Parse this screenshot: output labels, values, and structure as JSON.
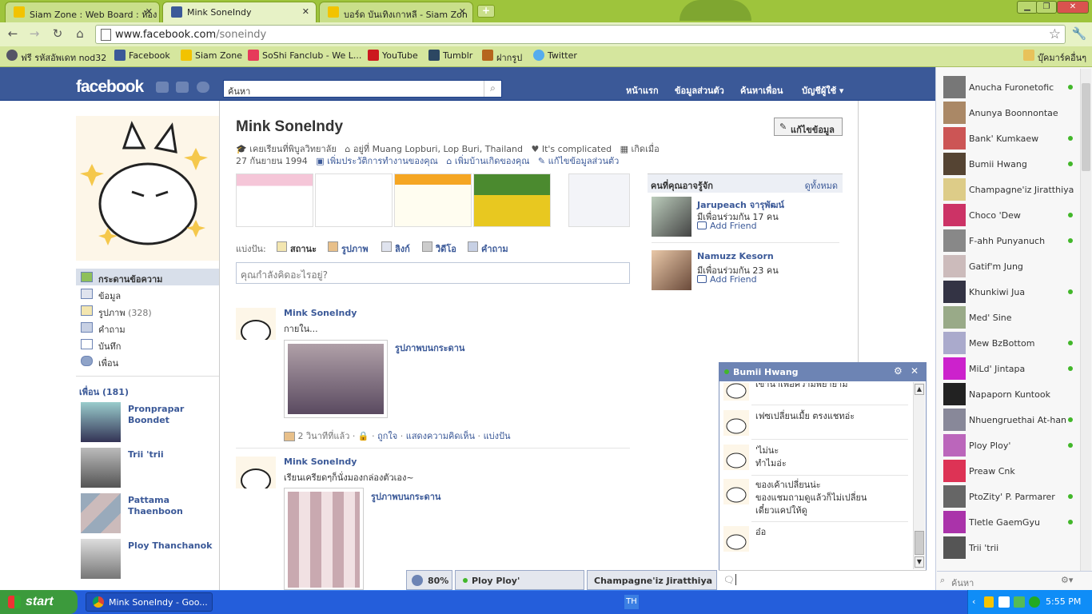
{
  "browser": {
    "tabs": [
      {
        "title": "Siam Zone : Web Board : ห้อง",
        "active": false
      },
      {
        "title": "Mink SoneIndy",
        "active": true
      },
      {
        "title": "บอร์ด บันเทิงเกาหลี - Siam Zon",
        "active": false
      }
    ],
    "url_domain": "www.facebook.com",
    "url_path": "/soneindy",
    "bookmarks": [
      "ฟรี รหัสอัพเดท nod32",
      "Facebook",
      "Siam Zone",
      "SoShi Fanclub - We L...",
      "YouTube",
      "Tumblr",
      "ฝากรูป",
      "Twitter"
    ],
    "other_bookmarks": "บุ๊คมาร์คอื่นๆ"
  },
  "fb": {
    "logo": "facebook",
    "search_placeholder": "ค้นหา",
    "nav": [
      "หน้าแรก",
      "ข้อมูลส่วนตัว",
      "ค้นหาเพื่อน",
      "บัญชีผู้ใช้ ▾"
    ]
  },
  "profile": {
    "name": "Mink SoneIndy",
    "edit_button": "แก้ไขข้อมูล",
    "info1": [
      "เคยเรียนที่พิบูลวิทยาลัย",
      "อยู่ที่ Muang Lopburi, Lop Buri, Thailand",
      "It's complicated",
      "เกิดเมื่อ"
    ],
    "info2_date": "27 กันยายน 1994",
    "info2_links": [
      "เพิ่มประวัติการทำงานของคุณ",
      "เพิ่มบ้านเกิดของคุณ",
      "แก้ไขข้อมูลส่วนตัว"
    ],
    "left_nav": [
      {
        "label": "กระดานข้อความ",
        "count": ""
      },
      {
        "label": "ข้อมูล",
        "count": ""
      },
      {
        "label": "รูปภาพ",
        "count": "(328)"
      },
      {
        "label": "คำถาม",
        "count": ""
      },
      {
        "label": "บันทึก",
        "count": ""
      },
      {
        "label": "เพื่อน",
        "count": ""
      }
    ],
    "friends_heading": "เพื่อน (181)",
    "friends": [
      "Pronprapar Boondet",
      "Trii 'trii",
      "Pattama Thaenboon",
      "Ploy Thanchanok"
    ],
    "share_label": "แบ่งปัน:",
    "share_items": [
      "สถานะ",
      "รูปภาพ",
      "ลิงก์",
      "วิดีโอ",
      "คำถาม"
    ],
    "status_placeholder": "คุณกำลังคิดอะไรอยู่?"
  },
  "stories": [
    {
      "author": "Mink SoneIndy",
      "text": "กายใน...",
      "attachment": "รูปภาพบนกระดาน",
      "meta_time": "2 วินาทีที่แล้ว",
      "actions": [
        "ถูกใจ",
        "แสดงความคิดเห็น",
        "แบ่งปัน"
      ]
    },
    {
      "author": "Mink SoneIndy",
      "text": "เรียนเครียดๆก็นั่งมองกล่องตัวเอง~",
      "attachment": "รูปภาพบนกระดาน"
    }
  ],
  "pymk": {
    "title": "คนที่คุณอาจรู้จัก",
    "see_all": "ดูทั้งหมด",
    "people": [
      {
        "name": "Jarupeach จารุพัฒน์",
        "mutual": "มีเพื่อนร่วมกัน 17 คน",
        "action": "Add Friend"
      },
      {
        "name": "Namuzz Kesorn",
        "mutual": "มีเพื่อนร่วมกัน 23 คน",
        "action": "Add Friend"
      }
    ]
  },
  "chat_sidebar": {
    "contacts": [
      {
        "name": "Anucha Furonetofic",
        "online": true
      },
      {
        "name": "Anunya Boonnontae",
        "online": false
      },
      {
        "name": "Bank' Kumkaew",
        "online": true
      },
      {
        "name": "Bumii Hwang",
        "online": true
      },
      {
        "name": "Champagne'iz Jiratthiya",
        "online": false
      },
      {
        "name": "Choco 'Dew",
        "online": true
      },
      {
        "name": "F-ahh Punyanuch",
        "online": true
      },
      {
        "name": "Gatif'm Jung",
        "online": false
      },
      {
        "name": "Khunkiwi Jua",
        "online": true
      },
      {
        "name": "Med' Sine",
        "online": false
      },
      {
        "name": "Mew BzBottom",
        "online": true
      },
      {
        "name": "MiLd' Jintapa",
        "online": true
      },
      {
        "name": "Napaporn Kuntook",
        "online": false
      },
      {
        "name": "Nhuengruethai At-han",
        "online": true
      },
      {
        "name": "Ploy Ploy'",
        "online": true
      },
      {
        "name": "Preaw Cnk",
        "online": false
      },
      {
        "name": "PtoZity' P. Parmarer",
        "online": true
      },
      {
        "name": "Tletle GaemGyu",
        "online": true
      },
      {
        "name": "Trii 'trii",
        "online": false
      }
    ],
    "search_placeholder": "ค้นหา"
  },
  "chat_window": {
    "title": "Bumii Hwang",
    "messages": [
      "เขาน่าเพื่อความพยายาม",
      "เฟซเปลี่ยนเมื้ย ตรงแชทอ่ะ",
      "'ไม่นะ\nทำไมอ่ะ",
      "ของเค้าเปลี่ยนน่ะ\nของแชมถามดูแล้วก็ไม่เปลี่ยน\nเดี๋ยวแคปให้ดู",
      "อ๋อ"
    ]
  },
  "chat_dock": {
    "online_pct": "80%",
    "tabs": [
      "Ploy Ploy'",
      "Champagne'iz Jiratthiya"
    ]
  },
  "taskbar": {
    "start": "start",
    "app": "Mink SoneIndy - Goo...",
    "lang": "TH",
    "clock": "5:55 PM"
  }
}
